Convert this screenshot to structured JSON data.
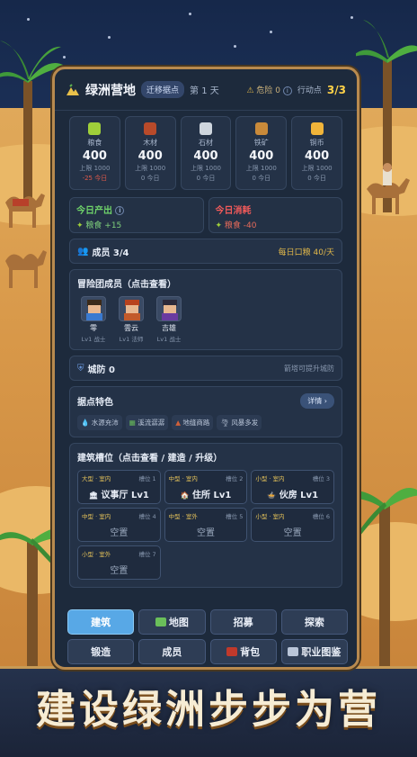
{
  "header": {
    "camp_name": "绿洲营地",
    "relocate_label": "迁移据点",
    "day_label": "第 1 天",
    "danger_label": "危险 0",
    "action_label": "行动点",
    "action_value": "3/3"
  },
  "resources": [
    {
      "name": "粮食",
      "value": "400",
      "cap": "上限 1000",
      "today": "-25 今日",
      "negative": true,
      "color": "#9fcf3a",
      "icon": "wheat-icon"
    },
    {
      "name": "木材",
      "value": "400",
      "cap": "上限 1000",
      "today": "0 今日",
      "negative": false,
      "color": "#b84a2a",
      "icon": "log-icon"
    },
    {
      "name": "石材",
      "value": "400",
      "cap": "上限 1000",
      "today": "0 今日",
      "negative": false,
      "color": "#cfd6de",
      "icon": "stone-icon"
    },
    {
      "name": "铁矿",
      "value": "400",
      "cap": "上限 1000",
      "today": "0 今日",
      "negative": false,
      "color": "#c98a3a",
      "icon": "pickaxe-icon"
    },
    {
      "name": "铜币",
      "value": "400",
      "cap": "上限 1000",
      "today": "0 今日",
      "negative": false,
      "color": "#f0b43a",
      "icon": "coin-icon"
    }
  ],
  "production": {
    "title": "今日产出",
    "detail": "粮食 +15"
  },
  "consumption": {
    "title": "今日消耗",
    "detail": "粮食 -40"
  },
  "members_bar": {
    "title": "成员 3/4",
    "ration": "每日口粮 40/天"
  },
  "team": {
    "title": "冒险团成员（点击查看）",
    "members": [
      {
        "name": "零",
        "level": "Lv1 战士",
        "hair": "#3a2a1a",
        "shirt": "#3a7ad0"
      },
      {
        "name": "雲云",
        "level": "Lv1 法师",
        "hair": "#b8421e",
        "shirt": "#c25a2a"
      },
      {
        "name": "吉雄",
        "level": "Lv1 战士",
        "hair": "#2c2a3a",
        "shirt": "#6a3aa0"
      }
    ]
  },
  "defense": {
    "title": "城防 0",
    "hint": "箭塔可提升城防"
  },
  "features": {
    "title": "据点特色",
    "detail_label": "详情",
    "tags": [
      "水源充沛",
      "溪流潺潺",
      "地缝商路",
      "风暴多发"
    ]
  },
  "buildings": {
    "title": "建筑槽位（点击查看 / 建造 / 升级）",
    "slots": [
      {
        "type": "大型 · 室内",
        "num": "槽位 1",
        "label": "议事厅 Lv1",
        "empty": false
      },
      {
        "type": "中型 · 室内",
        "num": "槽位 2",
        "label": "住所 Lv1",
        "empty": false
      },
      {
        "type": "小型 · 室内",
        "num": "槽位 3",
        "label": "伙房 Lv1",
        "empty": false
      },
      {
        "type": "中型 · 室内",
        "num": "槽位 4",
        "label": "空置",
        "empty": true
      },
      {
        "type": "中型 · 室外",
        "num": "槽位 5",
        "label": "空置",
        "empty": true
      },
      {
        "type": "小型 · 室内",
        "num": "槽位 6",
        "label": "空置",
        "empty": true
      },
      {
        "type": "小型 · 室外",
        "num": "槽位 7",
        "label": "空置",
        "empty": true
      }
    ]
  },
  "tabs": [
    {
      "label": "建筑",
      "active": true
    },
    {
      "label": "地图",
      "active": false
    },
    {
      "label": "招募",
      "active": false
    },
    {
      "label": "探索",
      "active": false
    },
    {
      "label": "锻造",
      "active": false
    },
    {
      "label": "成员",
      "active": false
    },
    {
      "label": "背包",
      "active": false
    },
    {
      "label": "职业图鉴",
      "active": false
    }
  ],
  "slogan": "建设绿洲步步为营"
}
